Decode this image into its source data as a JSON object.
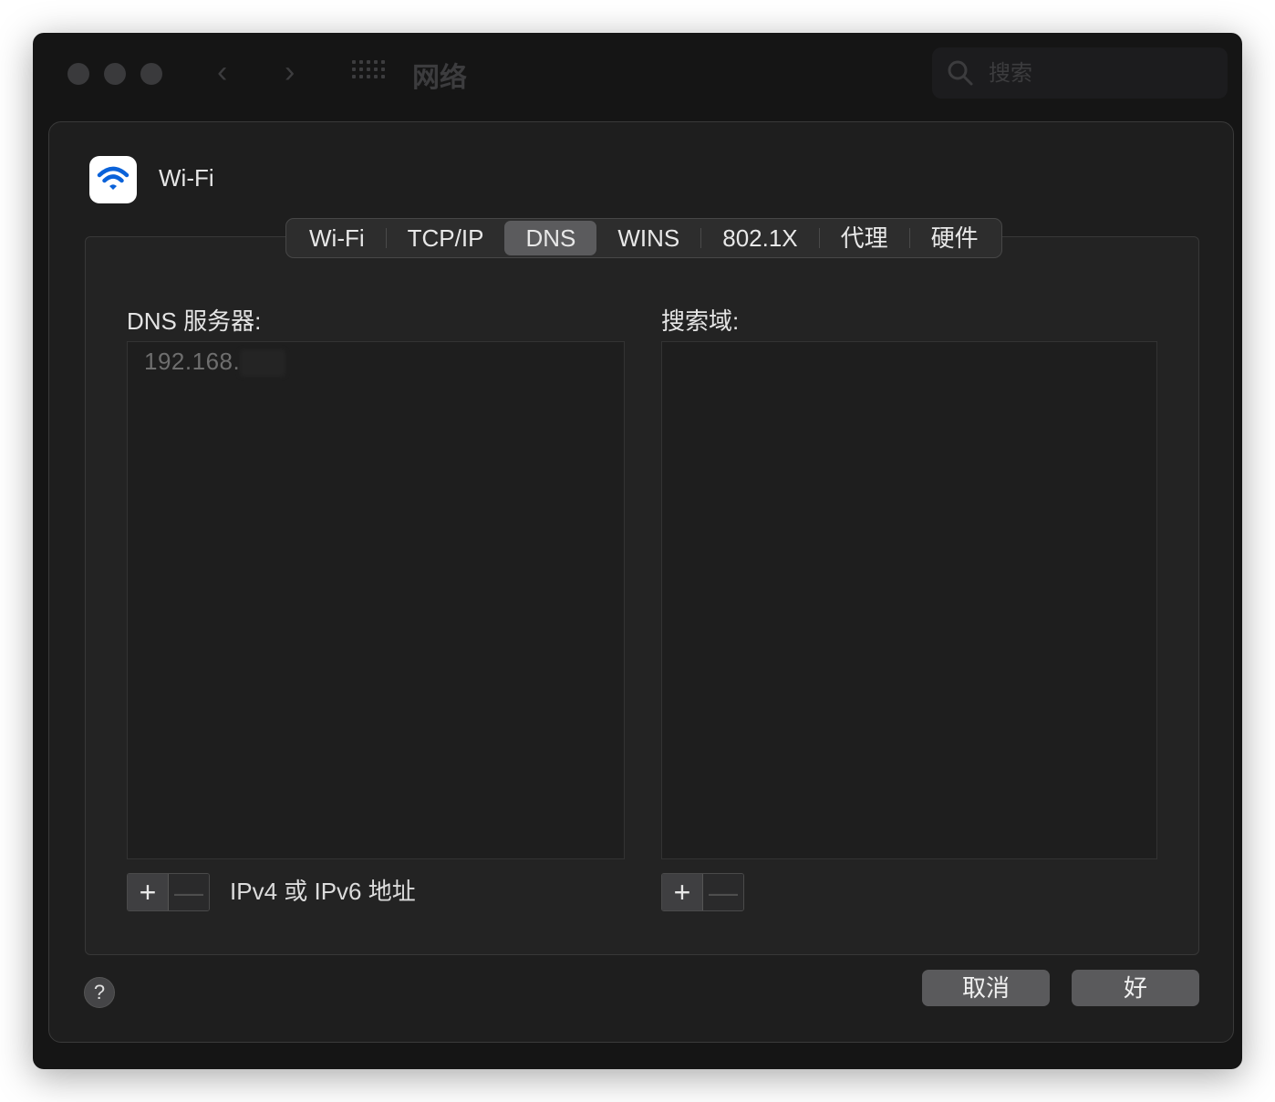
{
  "window": {
    "title": "网络",
    "search_placeholder": "搜索"
  },
  "service": {
    "name": "Wi-Fi",
    "icon": "wifi-icon",
    "icon_color": "#0a62d9"
  },
  "tabs": [
    {
      "label": "Wi-Fi",
      "active": false
    },
    {
      "label": "TCP/IP",
      "active": false
    },
    {
      "label": "DNS",
      "active": true
    },
    {
      "label": "WINS",
      "active": false
    },
    {
      "label": "802.1X",
      "active": false
    },
    {
      "label": "代理",
      "active": false
    },
    {
      "label": "硬件",
      "active": false
    }
  ],
  "dns": {
    "label": "DNS 服务器:",
    "servers": [
      "192.168."
    ],
    "hint": "IPv4 或 IPv6 地址"
  },
  "search_domains": {
    "label": "搜索域:",
    "items": []
  },
  "controls": {
    "add": "+",
    "remove": "—"
  },
  "buttons": {
    "help": "?",
    "cancel": "取消",
    "ok": "好"
  }
}
